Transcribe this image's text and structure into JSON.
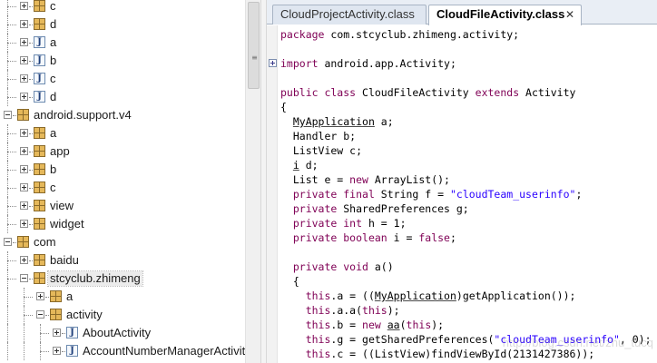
{
  "tree": {
    "items": [
      {
        "label": "c",
        "icon": "package-icon",
        "depth": 1,
        "expander": "plus"
      },
      {
        "label": "d",
        "icon": "package-icon",
        "depth": 1,
        "expander": "plus"
      },
      {
        "label": "a",
        "icon": "class-icon",
        "depth": 1,
        "expander": "plus"
      },
      {
        "label": "b",
        "icon": "class-icon",
        "depth": 1,
        "expander": "plus"
      },
      {
        "label": "c",
        "icon": "class-icon",
        "depth": 1,
        "expander": "plus"
      },
      {
        "label": "d",
        "icon": "class-icon",
        "depth": 1,
        "expander": "plus"
      },
      {
        "label": "android.support.v4",
        "icon": "package-icon",
        "depth": 0,
        "expander": "minus"
      },
      {
        "label": "a",
        "icon": "package-icon",
        "depth": 1,
        "expander": "plus"
      },
      {
        "label": "app",
        "icon": "package-icon",
        "depth": 1,
        "expander": "plus"
      },
      {
        "label": "b",
        "icon": "package-icon",
        "depth": 1,
        "expander": "plus"
      },
      {
        "label": "c",
        "icon": "package-icon",
        "depth": 1,
        "expander": "plus"
      },
      {
        "label": "view",
        "icon": "package-icon",
        "depth": 1,
        "expander": "plus"
      },
      {
        "label": "widget",
        "icon": "package-icon",
        "depth": 1,
        "expander": "plus"
      },
      {
        "label": "com",
        "icon": "package-icon",
        "depth": 0,
        "expander": "minus"
      },
      {
        "label": "baidu",
        "icon": "package-icon",
        "depth": 1,
        "expander": "plus"
      },
      {
        "label": "stcyclub.zhimeng",
        "icon": "package-icon",
        "depth": 1,
        "expander": "minus",
        "selected": true
      },
      {
        "label": "a",
        "icon": "package-icon",
        "depth": 2,
        "expander": "plus"
      },
      {
        "label": "activity",
        "icon": "package-icon",
        "depth": 2,
        "expander": "minus"
      },
      {
        "label": "AboutActivity",
        "icon": "class-icon",
        "depth": 3,
        "expander": "plus"
      },
      {
        "label": "AccountNumberManagerActivit",
        "icon": "class-icon",
        "depth": 3,
        "expander": "plus"
      }
    ],
    "scroll_grip": "≡"
  },
  "editor": {
    "tabs": [
      {
        "label": "CloudProjectActivity.class",
        "active": false
      },
      {
        "label": "CloudFileActivity.class",
        "active": true
      }
    ],
    "close_glyph": "✕",
    "lines": [
      [
        {
          "t": "package",
          "c": "kw"
        },
        {
          "t": " com.stcyclub.zhimeng.activity;"
        }
      ],
      [],
      [
        {
          "t": "import",
          "c": "kw"
        },
        {
          "t": " android.app.Activity;"
        }
      ],
      [],
      [
        {
          "t": "public class",
          "c": "kw"
        },
        {
          "t": " CloudFileActivity "
        },
        {
          "t": "extends",
          "c": "kw"
        },
        {
          "t": " Activity"
        }
      ],
      [
        {
          "t": "{"
        }
      ],
      [
        {
          "t": "  "
        },
        {
          "t": "MyApplication",
          "c": "ul"
        },
        {
          "t": " a;"
        }
      ],
      [
        {
          "t": "  Handler b;"
        }
      ],
      [
        {
          "t": "  ListView c;"
        }
      ],
      [
        {
          "t": "  "
        },
        {
          "t": "i",
          "c": "ul"
        },
        {
          "t": " d;"
        }
      ],
      [
        {
          "t": "  List e = "
        },
        {
          "t": "new",
          "c": "kw"
        },
        {
          "t": " ArrayList();"
        }
      ],
      [
        {
          "t": "  "
        },
        {
          "t": "private final",
          "c": "kw"
        },
        {
          "t": " String f = "
        },
        {
          "t": "\"cloudTeam_userinfo\"",
          "c": "str"
        },
        {
          "t": ";"
        }
      ],
      [
        {
          "t": "  "
        },
        {
          "t": "private",
          "c": "kw"
        },
        {
          "t": " SharedPreferences g;"
        }
      ],
      [
        {
          "t": "  "
        },
        {
          "t": "private int",
          "c": "kw"
        },
        {
          "t": " h = 1;"
        }
      ],
      [
        {
          "t": "  "
        },
        {
          "t": "private boolean",
          "c": "kw"
        },
        {
          "t": " i = "
        },
        {
          "t": "false",
          "c": "kw"
        },
        {
          "t": ";"
        }
      ],
      [],
      [
        {
          "t": "  "
        },
        {
          "t": "private void",
          "c": "kw"
        },
        {
          "t": " a()"
        }
      ],
      [
        {
          "t": "  {"
        }
      ],
      [
        {
          "t": "    "
        },
        {
          "t": "this",
          "c": "kw"
        },
        {
          "t": ".a = (("
        },
        {
          "t": "MyApplication",
          "c": "ul"
        },
        {
          "t": ")getApplication());"
        }
      ],
      [
        {
          "t": "    "
        },
        {
          "t": "this",
          "c": "kw"
        },
        {
          "t": ".a.a("
        },
        {
          "t": "this",
          "c": "kw"
        },
        {
          "t": ");"
        }
      ],
      [
        {
          "t": "    "
        },
        {
          "t": "this",
          "c": "kw"
        },
        {
          "t": ".b = "
        },
        {
          "t": "new",
          "c": "kw"
        },
        {
          "t": " "
        },
        {
          "t": "aa",
          "c": "ul"
        },
        {
          "t": "("
        },
        {
          "t": "this",
          "c": "kw"
        },
        {
          "t": ");"
        }
      ],
      [
        {
          "t": "    "
        },
        {
          "t": "this",
          "c": "kw"
        },
        {
          "t": ".g = getSharedPreferences("
        },
        {
          "t": "\"cloudTeam_userinfo\"",
          "c": "str"
        },
        {
          "t": ", 0);"
        }
      ],
      [
        {
          "t": "    "
        },
        {
          "t": "this",
          "c": "kw"
        },
        {
          "t": ".c = ((ListView)findViewById(2131427386));"
        }
      ]
    ]
  },
  "colors": {
    "keyword": "#7f0055",
    "string": "#2a00ff",
    "tab_active": "#ffffff",
    "tab_inactive": "#dfe6f0"
  },
  "watermark": "http://blog.csdn.net/zhu_tucq"
}
